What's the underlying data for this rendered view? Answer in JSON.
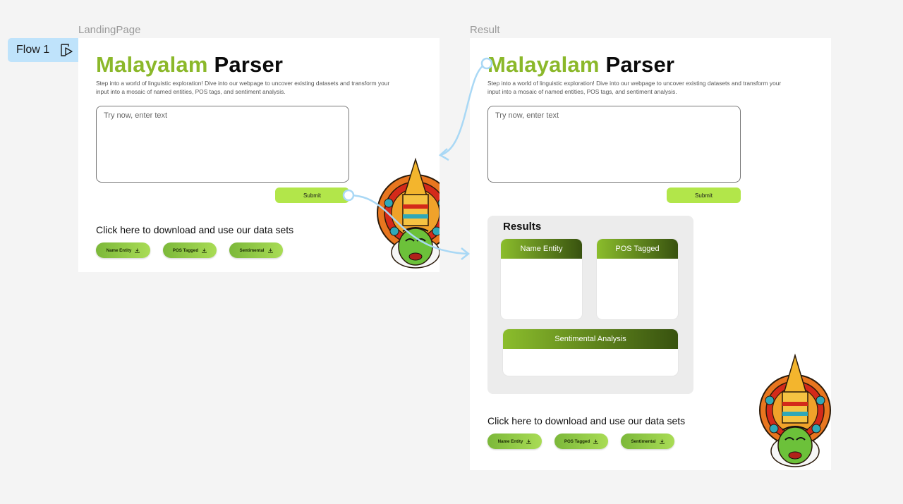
{
  "flow": {
    "label": "Flow 1",
    "icon": "play-flow-icon"
  },
  "frames": {
    "landing": {
      "name": "LandingPage"
    },
    "result": {
      "name": "Result"
    }
  },
  "page": {
    "title_part1": "Malayalam",
    "title_part2": "Parser",
    "description": "Step into a world of linguistic exploration! Dive into our webpage to uncover existing datasets and transform your input into a mosaic of named entities, POS tags, and sentiment analysis.",
    "input_placeholder": "Try now, enter text",
    "submit_label": "Submit",
    "download_heading": "Click here to download and use our data sets",
    "download_buttons": [
      "Name Entity",
      "POS Tagged",
      "Sentimental"
    ]
  },
  "results": {
    "heading": "Results",
    "cards": [
      "Name Entity",
      "POS Tagged",
      "Sentimental Analysis"
    ]
  },
  "colors": {
    "accent_green": "#8bb82a",
    "submit_green": "#b2e64a",
    "card_header_dark": "#38520f",
    "flow_blue": "#bfe3fb",
    "connector_blue": "#a9d8f5"
  },
  "icons": [
    "download-icon",
    "kathakali-illustration"
  ]
}
